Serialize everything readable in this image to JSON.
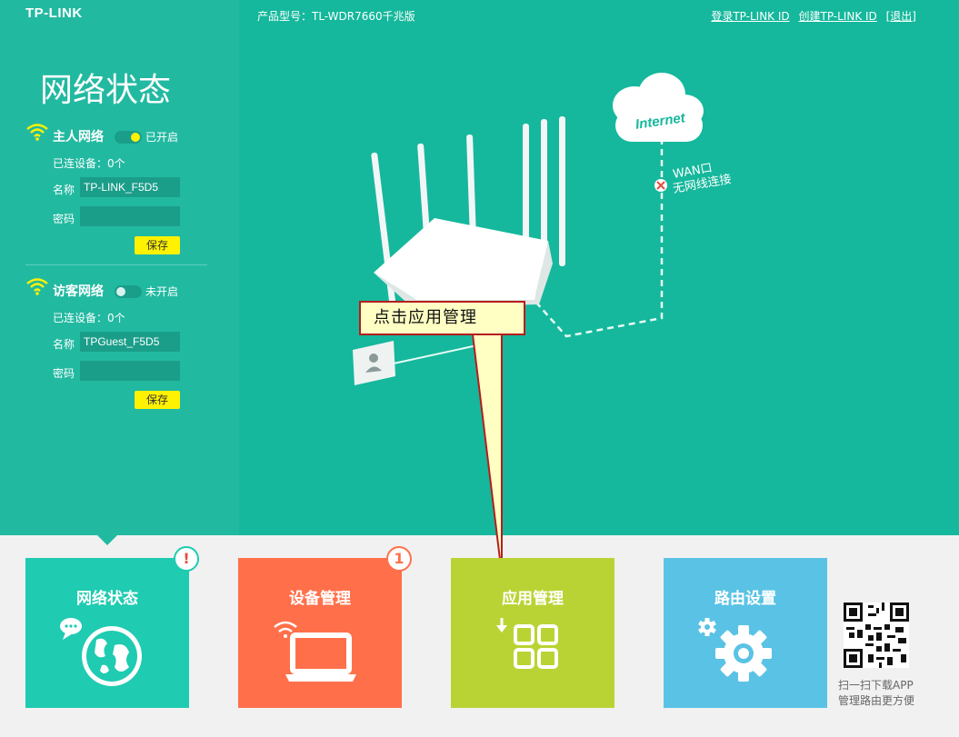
{
  "brand": "TP-LINK",
  "header": {
    "model": "产品型号：TL-WDR7660千兆版",
    "links": [
      "登录TP-LINK ID",
      "创建TP-LINK ID",
      "[退出]"
    ]
  },
  "panel": {
    "title": "网络状态",
    "main_network": {
      "name": "主人网络",
      "status": "已开启",
      "devices": "已连设备：0个",
      "ssid_label": "名称",
      "ssid": "TP-LINK_F5D5",
      "password_label": "密码",
      "password": "",
      "save": "保存"
    },
    "guest_network": {
      "name": "访客网络",
      "status": "未开启",
      "devices": "已连设备：0个",
      "ssid_label": "名称",
      "ssid": "TPGuest_F5D5",
      "password_label": "密码",
      "password": "",
      "save": "保存"
    }
  },
  "diagram": {
    "cloud": "Internet",
    "wan_port": "WAN口",
    "wan_status": "无网线连接"
  },
  "callout": "点击应用管理",
  "tiles": [
    {
      "label": "网络状态",
      "color": "#1fcbb1",
      "badge": "!"
    },
    {
      "label": "设备管理",
      "color": "#ff704a",
      "badge": "1"
    },
    {
      "label": "应用管理",
      "color": "#bad334",
      "badge": ""
    },
    {
      "label": "路由设置",
      "color": "#5ac3e5",
      "badge": ""
    }
  ],
  "qr_caption": [
    "扫一扫下载APP",
    "管理路由更方便"
  ],
  "colors": {
    "panel": "#22b9a1",
    "main": "#15b89c",
    "save_button": "#fff200",
    "alert": "#e74c3c"
  }
}
